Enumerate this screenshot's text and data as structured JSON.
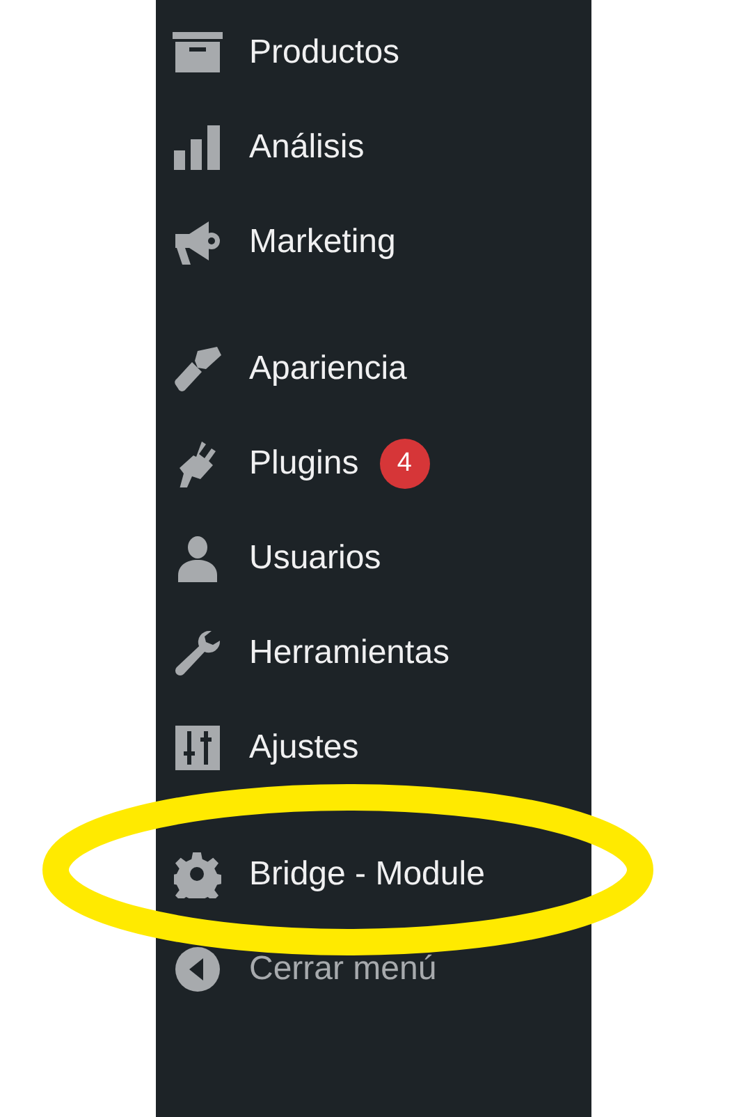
{
  "menu": {
    "groups": [
      {
        "items": [
          {
            "label": "Productos",
            "highlighted": false
          },
          {
            "label": "Análisis",
            "highlighted": false
          },
          {
            "label": "Marketing",
            "highlighted": false
          }
        ]
      },
      {
        "items": [
          {
            "label": "Apariencia",
            "highlighted": false
          },
          {
            "label": "Plugins",
            "badge": "4",
            "highlighted": false
          },
          {
            "label": "Usuarios",
            "highlighted": false
          },
          {
            "label": "Herramientas",
            "highlighted": false
          },
          {
            "label": "Ajustes",
            "highlighted": false
          }
        ]
      },
      {
        "items": [
          {
            "label": "Bridge - Module",
            "highlighted": true
          }
        ]
      }
    ]
  },
  "collapse_button": {
    "label": "Cerrar menú"
  }
}
